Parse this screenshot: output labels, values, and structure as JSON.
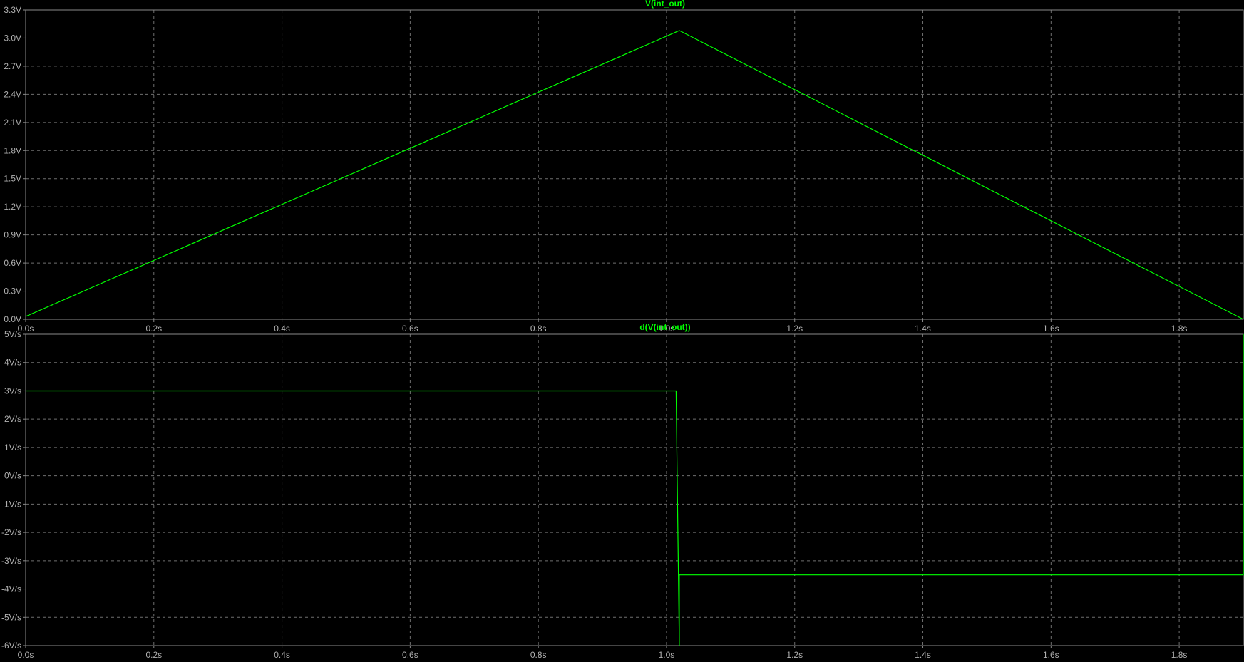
{
  "chart_data": [
    {
      "type": "line",
      "title": "V(int_out)",
      "xlabel": "",
      "ylabel": "",
      "xlim": [
        0.0,
        1.9
      ],
      "ylim": [
        0.0,
        3.3
      ],
      "x_ticks": [
        "0.0s",
        "0.2s",
        "0.4s",
        "0.6s",
        "0.8s",
        "1.0s",
        "1.2s",
        "1.4s",
        "1.6s",
        "1.8s"
      ],
      "y_ticks": [
        "0.0V",
        "0.3V",
        "0.6V",
        "0.9V",
        "1.2V",
        "1.5V",
        "1.8V",
        "2.1V",
        "2.4V",
        "2.7V",
        "3.0V",
        "3.3V"
      ],
      "grid": true,
      "color": "#00ff00",
      "series": [
        {
          "name": "V(int_out)",
          "x": [
            0.0,
            1.02,
            1.9
          ],
          "y": [
            0.03,
            3.08,
            0.0
          ]
        }
      ]
    },
    {
      "type": "line",
      "title": "d(V(int_out))",
      "xlabel": "",
      "ylabel": "",
      "xlim": [
        0.0,
        1.9
      ],
      "ylim": [
        -6,
        5
      ],
      "x_ticks": [
        "0.0s",
        "0.2s",
        "0.4s",
        "0.6s",
        "0.8s",
        "1.0s",
        "1.2s",
        "1.4s",
        "1.6s",
        "1.8s"
      ],
      "y_ticks": [
        "-6V/s",
        "-5V/s",
        "-4V/s",
        "-3V/s",
        "-2V/s",
        "-1V/s",
        "0V/s",
        "1V/s",
        "2V/s",
        "3V/s",
        "4V/s",
        "5V/s"
      ],
      "grid": true,
      "color": "#00ff00",
      "series": [
        {
          "name": "d(V(int_out))",
          "x": [
            0.0,
            1.015,
            1.02,
            1.02,
            1.9,
            1.9
          ],
          "y": [
            3.0,
            3.0,
            -6.0,
            -3.5,
            -3.5,
            5.0
          ]
        }
      ]
    }
  ]
}
